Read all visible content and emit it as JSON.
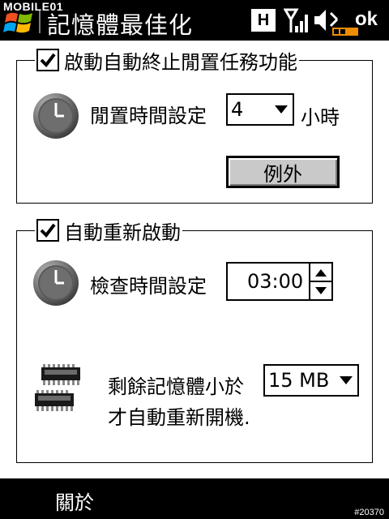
{
  "titlebar": {
    "watermark": "MOBILE01",
    "title": "記憶體最佳化",
    "h_indicator": "H",
    "ok_label": "ok"
  },
  "group_auto_terminate": {
    "checkbox_label": "啟動自動終止閒置任務功能",
    "checked": true,
    "idle_time_label": "閒置時間設定",
    "idle_time_value": "4",
    "idle_time_unit": "小時",
    "exceptions_button": "例外"
  },
  "group_auto_restart": {
    "checkbox_label": "自動重新啟動",
    "checked": true,
    "check_time_label": "檢查時間設定",
    "check_time_value": "03:00",
    "memory_label_line1": "剩餘記憶體小於",
    "memory_label_line2": "才自動重新開機.",
    "memory_value": "15 MB"
  },
  "menubar": {
    "left_softkey": "關於",
    "watermark": "#20370"
  },
  "colors": {
    "bar_background": "#000000",
    "button_face": "#c9c9c9",
    "battery_orange": "#f08c00"
  }
}
